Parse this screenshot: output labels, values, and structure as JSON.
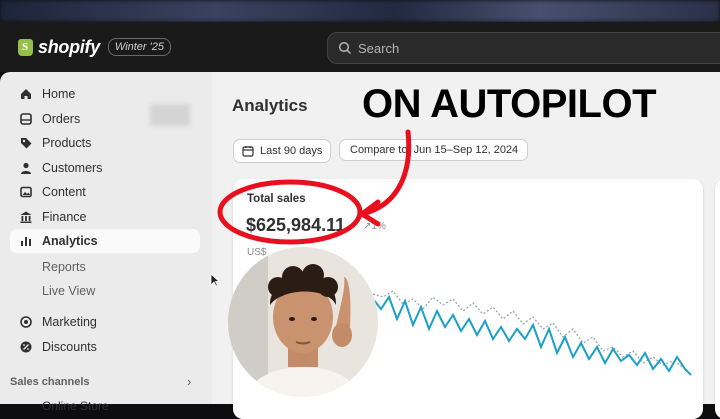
{
  "topbar": {
    "logo_text": "shopify",
    "version_badge": "Winter '25",
    "search_placeholder": "Search"
  },
  "sidebar": {
    "items": [
      {
        "label": "Home",
        "icon": "home-icon"
      },
      {
        "label": "Orders",
        "icon": "orders-icon"
      },
      {
        "label": "Products",
        "icon": "tag-icon"
      },
      {
        "label": "Customers",
        "icon": "person-icon"
      },
      {
        "label": "Content",
        "icon": "content-icon"
      },
      {
        "label": "Finance",
        "icon": "bank-icon"
      },
      {
        "label": "Analytics",
        "icon": "bar-chart-icon",
        "active": true
      }
    ],
    "analytics_sub": [
      "Reports",
      "Live View"
    ],
    "items2": [
      {
        "label": "Marketing",
        "icon": "target-icon"
      },
      {
        "label": "Discounts",
        "icon": "discount-icon"
      }
    ],
    "sales_channels_label": "Sales channels",
    "online_store": "Online Store"
  },
  "main": {
    "page_title": "Analytics",
    "date_range": "Last 90 days",
    "compare_label": "Compare to: Jun 15–Sep 12, 2024"
  },
  "total_sales": {
    "label": "Total sales",
    "value": "$625,984.11",
    "change": "↗1%",
    "currency": "US$"
  },
  "overlay": {
    "title": "ON AUTOPILOT"
  },
  "colors": {
    "series_current": "#1aa0c8",
    "series_previous": "#9aa5ad",
    "annotation_red": "#e8101e"
  }
}
